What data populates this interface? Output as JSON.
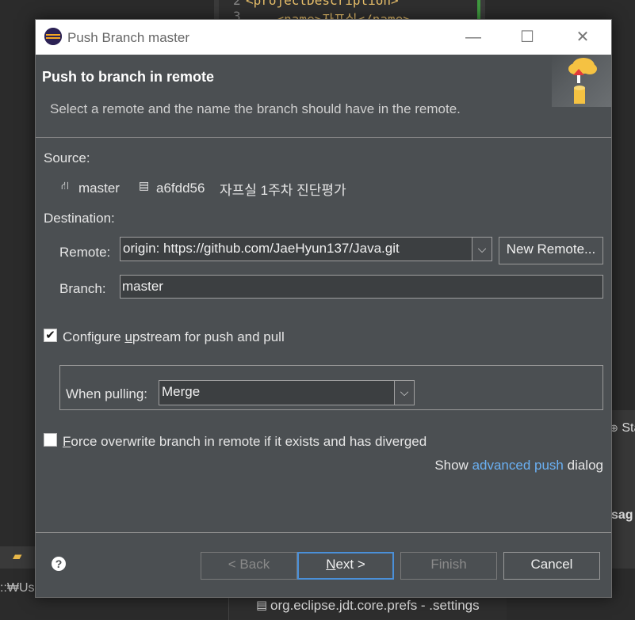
{
  "background": {
    "editor_line_numbers": [
      "2",
      "3"
    ],
    "editor_code_lines": [
      "<projectDescription>",
      "    <name>자프실</name>"
    ],
    "right_panel_tab": "Sta",
    "right_panel_text": "sag",
    "left_panel_path": "::₩Use",
    "bottom_file": "org.eclipse.jdt.core.prefs - .settings"
  },
  "dialog": {
    "title": "Push Branch master",
    "window_buttons": {
      "minimize": "—",
      "maximize": "☐",
      "close": "✕"
    },
    "heading": "Push to branch in remote",
    "description": "Select a remote and the name the branch should have in the remote.",
    "source": {
      "label": "Source:",
      "branch": "master",
      "commit_id": "a6fdd56",
      "commit_message": "자프실 1주차 진단평가"
    },
    "destination": {
      "label": "Destination:",
      "remote_label": "Remote:",
      "remote_value": "origin: https://github.com/JaeHyun137/Java.git",
      "new_remote_button": "New Remote...",
      "branch_label": "Branch:",
      "branch_value": "master"
    },
    "configure_upstream": {
      "checked": true,
      "label_pre": "Configure ",
      "label_ul": "u",
      "label_post": "pstream for push and pull"
    },
    "when_pulling": {
      "label": "When pulling:",
      "value": "Merge"
    },
    "force_overwrite": {
      "checked": false,
      "label_ul": "F",
      "label_post": "orce overwrite branch in remote if it exists and has diverged"
    },
    "advanced": {
      "pre": "Show ",
      "link": "advanced push",
      "post": " dialog"
    },
    "buttons": {
      "back": "< Back",
      "next_ul": "N",
      "next_post": "ext >",
      "finish": "Finish",
      "cancel": "Cancel"
    },
    "help_symbol": "?"
  }
}
